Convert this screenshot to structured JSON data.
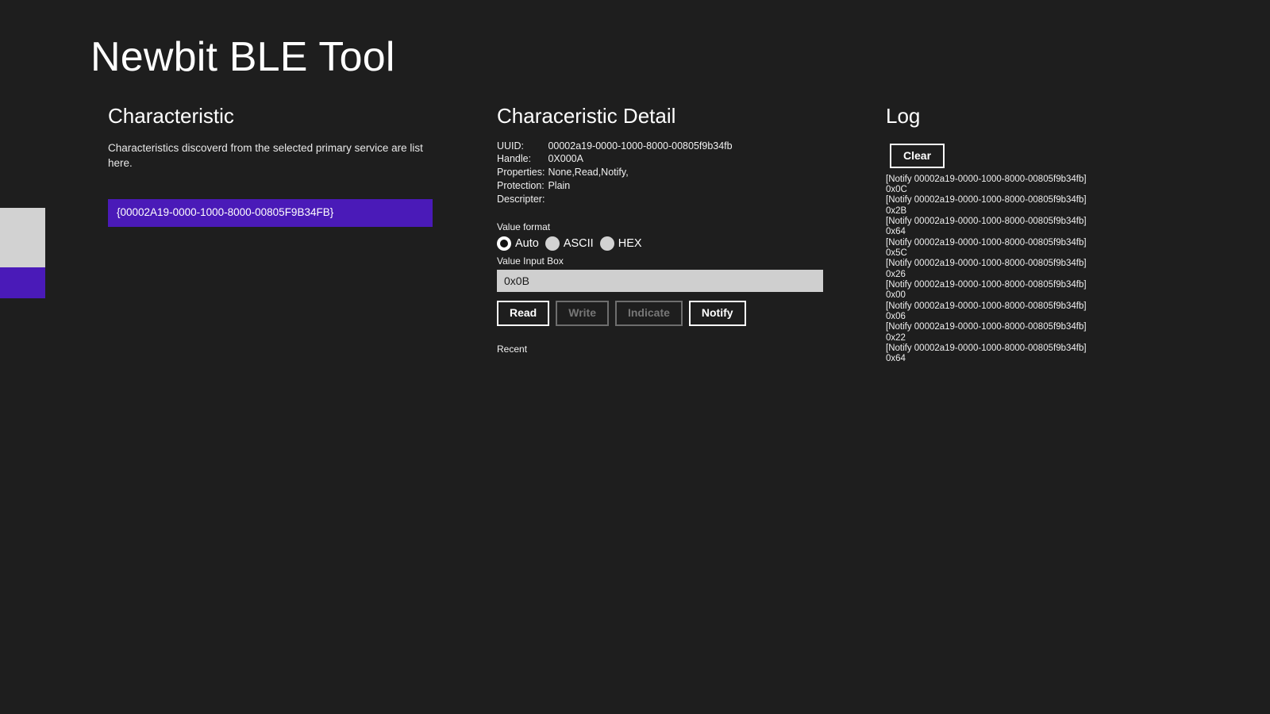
{
  "app": {
    "title": "Newbit BLE Tool",
    "background_color": "#1e1e1e",
    "accent_color": "#4a1ab8"
  },
  "left_sliver": {
    "gray_block_color": "#d2d2d2",
    "accent_block_color": "#4a1ab8"
  },
  "characteristic_panel": {
    "heading": "Characteristic",
    "description": "Characteristics discoverd from the selected primary service are list here.",
    "items": [
      {
        "label": "{00002A19-0000-1000-8000-00805F9B34FB}",
        "selected": true
      }
    ]
  },
  "detail_panel": {
    "heading": "Characeristic Detail",
    "fields": [
      {
        "label": "UUID:",
        "value": "00002a19-0000-1000-8000-00805f9b34fb"
      },
      {
        "label": "Handle:",
        "value": "0X000A"
      },
      {
        "label": "Properties:",
        "value": "None,Read,Notify,"
      },
      {
        "label": "Protection:",
        "value": "Plain"
      },
      {
        "label": "Descripter:",
        "value": ""
      }
    ],
    "value_format": {
      "label": "Value format",
      "options": [
        {
          "label": "Auto",
          "selected": true
        },
        {
          "label": "ASCII",
          "selected": false
        },
        {
          "label": "HEX",
          "selected": false
        }
      ]
    },
    "value_input": {
      "label": "Value Input Box",
      "value": "0x0B",
      "placeholder": ""
    },
    "buttons": [
      {
        "label": "Read",
        "enabled": true
      },
      {
        "label": "Write",
        "enabled": false
      },
      {
        "label": "Indicate",
        "enabled": false
      },
      {
        "label": "Notify",
        "enabled": true
      }
    ],
    "recent_label": "Recent"
  },
  "log_panel": {
    "heading": "Log",
    "clear_label": "Clear",
    "entries": [
      {
        "header": "[Notify 00002a19-0000-1000-8000-00805f9b34fb]",
        "value": "0x0C"
      },
      {
        "header": "[Notify 00002a19-0000-1000-8000-00805f9b34fb]",
        "value": "0x2B"
      },
      {
        "header": "[Notify 00002a19-0000-1000-8000-00805f9b34fb]",
        "value": "0x64"
      },
      {
        "header": "[Notify 00002a19-0000-1000-8000-00805f9b34fb]",
        "value": "0x5C"
      },
      {
        "header": "[Notify 00002a19-0000-1000-8000-00805f9b34fb]",
        "value": "0x26"
      },
      {
        "header": "[Notify 00002a19-0000-1000-8000-00805f9b34fb]",
        "value": "0x00"
      },
      {
        "header": "[Notify 00002a19-0000-1000-8000-00805f9b34fb]",
        "value": "0x06"
      },
      {
        "header": "[Notify 00002a19-0000-1000-8000-00805f9b34fb]",
        "value": "0x22"
      },
      {
        "header": "[Notify 00002a19-0000-1000-8000-00805f9b34fb]",
        "value": "0x64"
      }
    ]
  }
}
